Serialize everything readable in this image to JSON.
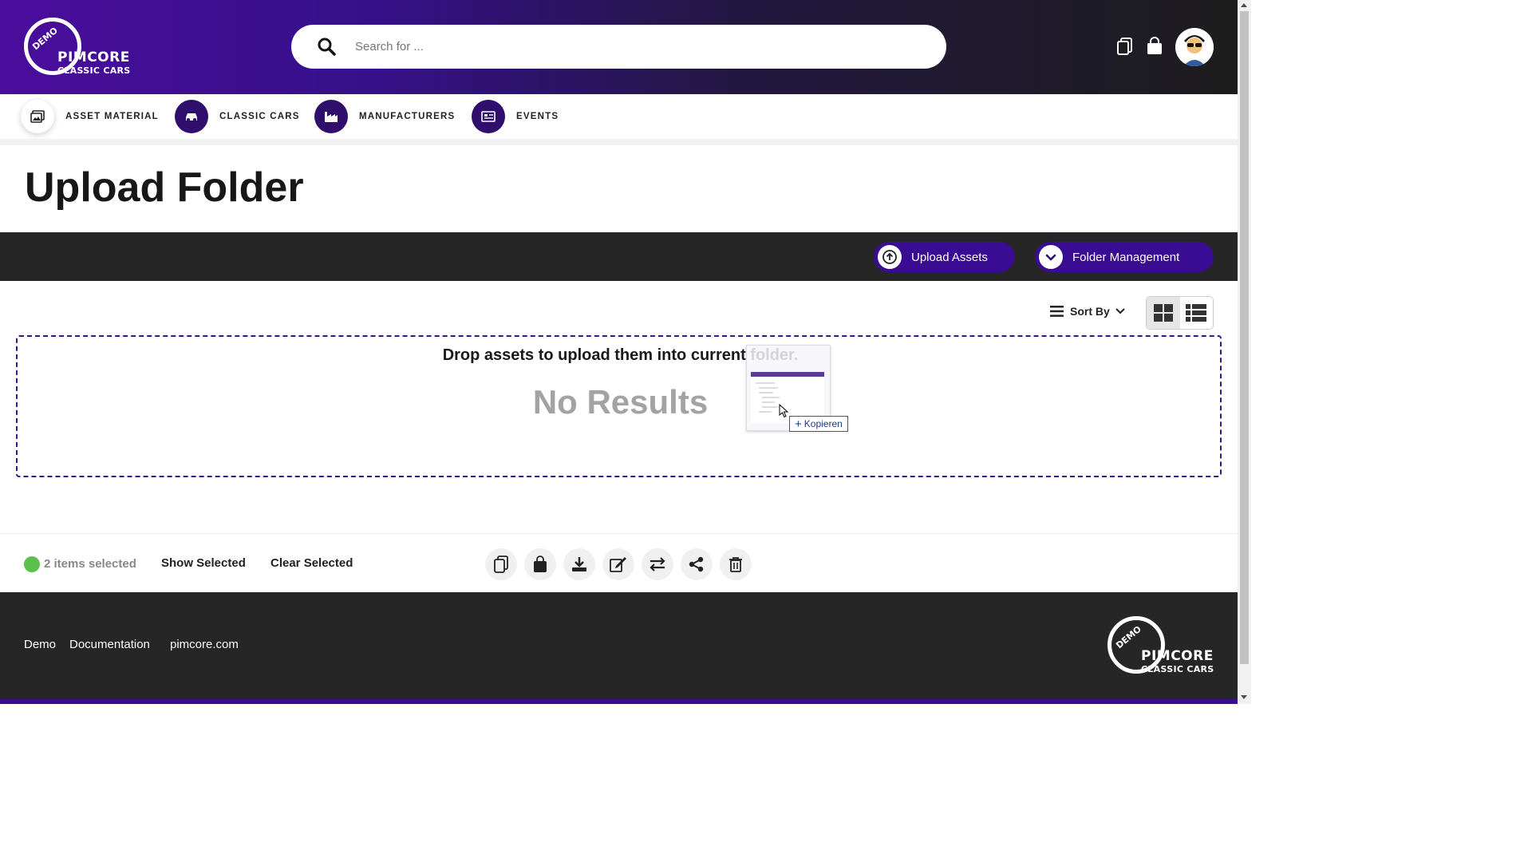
{
  "brand": {
    "logo_badge": "DEMO",
    "logo_name": "PIMCORE",
    "logo_sub": "CLASSIC CARS"
  },
  "search": {
    "placeholder": "Search for ..."
  },
  "nav": {
    "items": [
      {
        "label": "ASSET MATERIAL",
        "icon": "images-icon"
      },
      {
        "label": "CLASSIC CARS",
        "icon": "car-icon"
      },
      {
        "label": "MANUFACTURERS",
        "icon": "factory-icon"
      },
      {
        "label": "EVENTS",
        "icon": "newspaper-icon"
      }
    ]
  },
  "page": {
    "title": "Upload Folder"
  },
  "toolbar": {
    "upload_label": "Upload Assets",
    "folder_label": "Folder Management"
  },
  "sort": {
    "label": "Sort By"
  },
  "dropzone": {
    "instruction": "Drop assets to upload them into current folder.",
    "empty": "No Results",
    "drag_tooltip": "Kopieren"
  },
  "selection": {
    "count_text": "2 items selected",
    "show_label": "Show Selected",
    "clear_label": "Clear Selected"
  },
  "footer": {
    "links": [
      "Demo",
      "Documentation",
      "pimcore.com"
    ]
  },
  "colors": {
    "brand_purple": "#3a0c93",
    "dark": "#262626",
    "selected_dot": "#5ac24b"
  }
}
